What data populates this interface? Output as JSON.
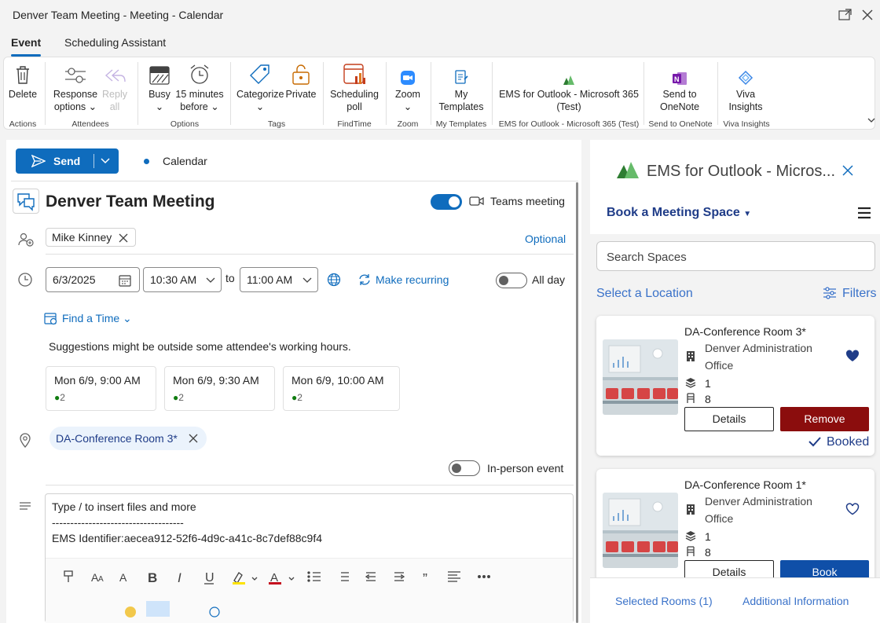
{
  "window": {
    "title": "Denver Team Meeting - Meeting - Calendar"
  },
  "tabs": [
    "Event",
    "Scheduling Assistant"
  ],
  "ribbon": {
    "buttons": {
      "delete": "Delete",
      "response1": "Response",
      "response2": "options",
      "reply1": "Reply",
      "reply2": "all",
      "busy": "Busy",
      "reminder1": "15 minutes",
      "reminder2": "before",
      "categorize": "Categorize",
      "private": "Private",
      "poll1": "Scheduling",
      "poll2": "poll",
      "zoom": "Zoom",
      "templates1": "My",
      "templates2": "Templates",
      "ems1": "EMS for Outlook - Microsoft 365",
      "ems2": "(Test)",
      "onenote1": "Send to",
      "onenote2": "OneNote",
      "viva1": "Viva",
      "viva2": "Insights"
    },
    "groups": {
      "actions": "Actions",
      "attendees": "Attendees",
      "options": "Options",
      "tags": "Tags",
      "findtime": "FindTime",
      "zoom": "Zoom",
      "templates": "My Templates",
      "ems": "EMS for Outlook - Microsoft 365 (Test)",
      "onenote": "Send to OneNote",
      "viva": "Viva Insights"
    }
  },
  "compose": {
    "send_label": "Send",
    "calendar_label": "Calendar",
    "meeting_title": "Denver Team Meeting",
    "teams_label": "Teams meeting",
    "attendee": "Mike Kinney",
    "optional_label": "Optional",
    "start_date": "6/3/2025",
    "start_time": "10:30 AM",
    "to_label": "to",
    "end_time": "11:00 AM",
    "recurring_label": "Make recurring",
    "allday_label": "All day",
    "find_time_label": "Find a Time",
    "suggestion_note": "Suggestions might be outside some attendee's working hours.",
    "suggestions": [
      {
        "time": "Mon 6/9, 9:00 AM",
        "count": "2"
      },
      {
        "time": "Mon 6/9, 9:30 AM",
        "count": "2"
      },
      {
        "time": "Mon 6/9, 10:00 AM",
        "count": "2"
      }
    ],
    "location": "DA-Conference Room 3*",
    "inperson_label": "In-person event",
    "body_line1": "Type / to insert files and more",
    "body_line2": "------------------------------------",
    "body_line3": "EMS Identifier:aecea912-52f6-4d9c-a41c-8c7def88c9f4"
  },
  "addin": {
    "title": "EMS for Outlook - Micros...",
    "book_label": "Book a Meeting Space",
    "search_placeholder": "Search Spaces",
    "select_location": "Select a Location",
    "filters_label": "Filters",
    "rooms": [
      {
        "name": "DA-Conference Room 3*",
        "building1": "Denver Administration",
        "building2": "Office",
        "floor": "1",
        "capacity": "8",
        "details": "Details",
        "action": "Remove",
        "status": "Booked"
      },
      {
        "name": "DA-Conference Room 1*",
        "building1": "Denver Administration",
        "building2": "Office",
        "floor": "1",
        "capacity": "8",
        "details": "Details",
        "action": "Book"
      }
    ],
    "footer": {
      "selected": "Selected Rooms (1)",
      "additional": "Additional Information"
    }
  },
  "colors": {
    "accent": "#0f6cbd",
    "remove": "#8b0d0d",
    "book": "#0f4fa8",
    "navy": "#1f3c88"
  }
}
